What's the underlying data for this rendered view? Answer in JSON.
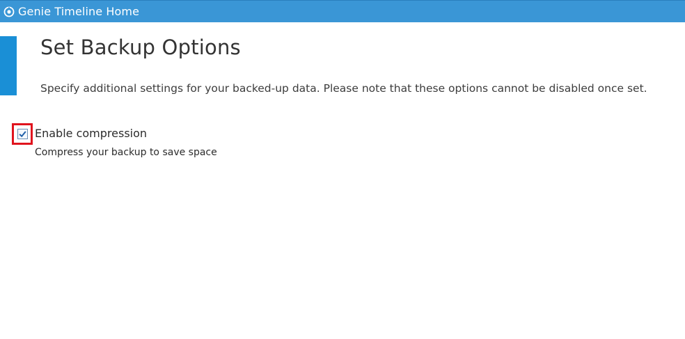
{
  "window": {
    "title": "Genie Timeline Home",
    "icon": "genie-logo-icon",
    "accent_color": "#3a96d6"
  },
  "page": {
    "title": "Set Backup Options",
    "description": "Specify additional settings for your backed-up data. Please note that these options cannot be disabled once set."
  },
  "options": {
    "compression": {
      "label": "Enable compression",
      "hint": "Compress your backup to save space",
      "checked": true,
      "highlight_color": "#e0141e"
    }
  }
}
